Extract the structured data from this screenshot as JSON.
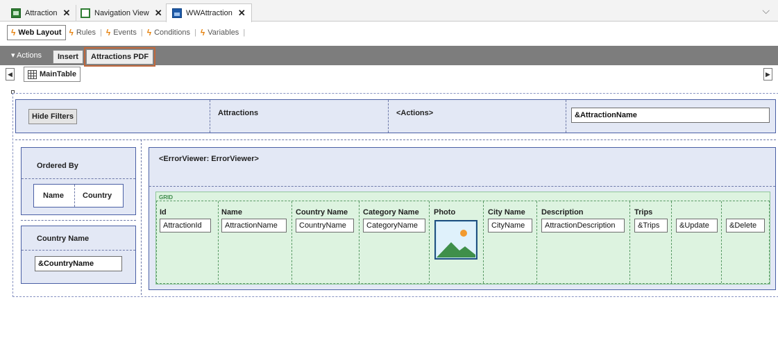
{
  "tabs": [
    {
      "label": "Attraction",
      "icon": "table-icon"
    },
    {
      "label": "Navigation View",
      "icon": "document-icon"
    },
    {
      "label": "WWAttraction",
      "icon": "webpanel-icon"
    }
  ],
  "subtabs": [
    "Web Layout",
    "Rules",
    "Events",
    "Conditions",
    "Variables"
  ],
  "actions": {
    "label": "Actions",
    "buttons": [
      "Insert",
      "Attractions PDF"
    ]
  },
  "main_table": "MainTable",
  "header": {
    "hide_filters": "Hide Filters",
    "title": "Attractions",
    "actions_placeholder": "<Actions>",
    "search_field": "&AttractionName"
  },
  "filters": {
    "ordered_by": "Ordered By",
    "order_options": [
      "Name",
      "Country"
    ],
    "country_label": "Country Name",
    "country_field": "&CountryName"
  },
  "error_viewer": "<ErrorViewer: ErrorViewer>",
  "grid": {
    "label": "GRID",
    "columns": [
      {
        "title": "Id",
        "field": "AttractionId"
      },
      {
        "title": "Name",
        "field": "AttractionName"
      },
      {
        "title": "Country Name",
        "field": "CountryName"
      },
      {
        "title": "Category Name",
        "field": "CategoryName"
      },
      {
        "title": "Photo",
        "field": ""
      },
      {
        "title": "City Name",
        "field": "CityName"
      },
      {
        "title": "Description",
        "field": "AttractionDescription"
      },
      {
        "title": "Trips",
        "field": "&Trips"
      },
      {
        "title": "",
        "field": "&Update"
      },
      {
        "title": "",
        "field": "&Delete"
      }
    ]
  }
}
